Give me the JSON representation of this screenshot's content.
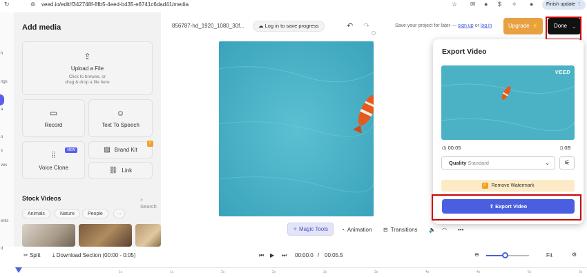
{
  "browser": {
    "url": "veed.io/edit/f342748f-8fb5-4eed-b435-e6741c6dad41/media",
    "finish_update": "Finish update"
  },
  "rail": {
    "labels": [
      "h",
      "ngs",
      "a",
      "o",
      "s",
      "ves",
      "ents",
      "d"
    ]
  },
  "panel": {
    "title": "Add media",
    "upload": {
      "label": "Upload a File",
      "sub1": "Click to browse, or",
      "sub2": "drag & drop a file here"
    },
    "record": "Record",
    "tts": "Text To Speech",
    "voice_clone": "Voice Clone",
    "new_badge": "NEW",
    "brand_kit": "Brand Kit",
    "link": "Link",
    "stock_title": "Stock Videos",
    "search": "Search",
    "chips": [
      "Animals",
      "Nature",
      "People"
    ],
    "more": "···"
  },
  "header": {
    "filename": "856787-hd_1920_1080_30f...",
    "login": "Log in to save progress",
    "save_text": "Save your project for later —",
    "sign_up": "sign up",
    "or": "or",
    "log_in": "log in",
    "upgrade": "Upgrade",
    "done": "Done"
  },
  "toolbar": {
    "magic": "Magic Tools",
    "animation": "Animation",
    "transitions": "Transitions"
  },
  "timeline": {
    "split": "Split",
    "download": "Download Section",
    "range": "(00:00 - 0:05)",
    "current": "00:00.0",
    "sep": "/",
    "total": "00:05.5",
    "fit": "Fit",
    "zoom": 0.45,
    "ticks": [
      "1s",
      "1s",
      "2s",
      "2s",
      "3s",
      "3s",
      "4s",
      "4s",
      "5s",
      "5s"
    ]
  },
  "modal": {
    "title": "Export Video",
    "logo": "VEED",
    "duration": "00:05",
    "size": "0B",
    "quality_label": "Quality",
    "quality_value": "Standard",
    "remove_watermark": "Remove Watermark",
    "export": "Export Video"
  },
  "colors": {
    "accent": "#4a5fe0",
    "upgrade": "#e8a040",
    "water": "#4ab3c8",
    "highlight": "#cc0000"
  }
}
